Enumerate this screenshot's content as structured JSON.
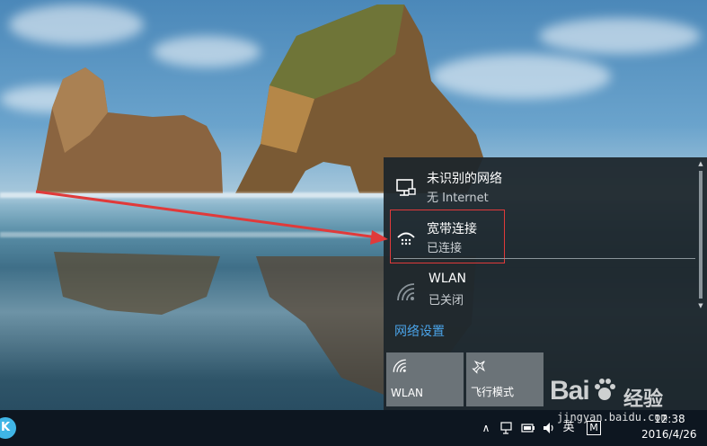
{
  "network_flyout": {
    "networks": [
      {
        "name": "未识别的网络",
        "status": "无 Internet",
        "icon": "ethernet-monitor-icon"
      },
      {
        "name": "宽带连接",
        "status": "已连接",
        "icon": "dialup-connection-icon"
      },
      {
        "name": "WLAN",
        "status": "已关闭",
        "icon": "wifi-icon"
      }
    ],
    "settings_link": "网络设置",
    "quick_actions": [
      {
        "label": "WLAN",
        "icon": "wifi-icon"
      },
      {
        "label": "飞行模式",
        "icon": "airplane-icon"
      }
    ]
  },
  "taskbar": {
    "start_letter": "K",
    "tray": {
      "chevron": "∧",
      "input_language": "英",
      "ime_badge": "M"
    },
    "clock": {
      "time": "12:38",
      "date": "2016/4/26"
    }
  },
  "watermark": {
    "logo_left": "Bai",
    "logo_right": "经验",
    "url": "jingyan.baidu.com"
  },
  "colors": {
    "flyout_bg": "#1e262c",
    "link": "#4aa3e8",
    "annotation_red": "#e03a3a",
    "tile_bg": "#6b7378",
    "taskbar_bg": "#0d1620"
  }
}
